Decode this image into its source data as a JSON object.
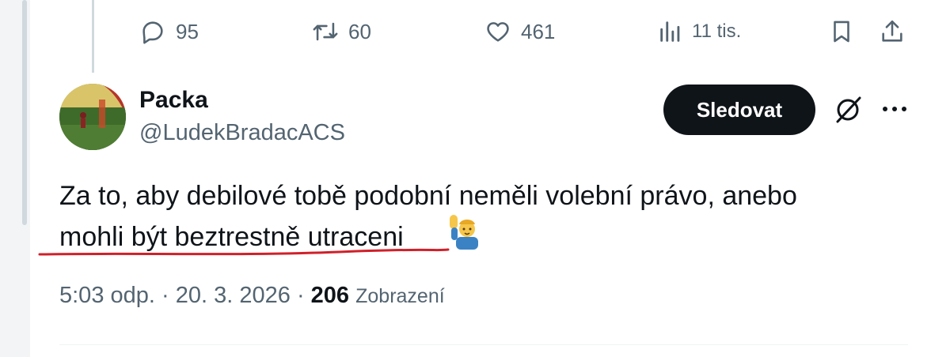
{
  "prev_tweet_actions": {
    "replies": "95",
    "retweets": "60",
    "likes": "461",
    "views": "11 tis."
  },
  "icons": {
    "reply": "reply-icon",
    "retweet": "retweet-icon",
    "like": "heart-icon",
    "views": "analytics-icon",
    "bookmark": "bookmark-icon",
    "share": "share-icon",
    "grok": "grok-icon",
    "more": "more-icon",
    "emoji": "man-raising-hand-emoji"
  },
  "tweet": {
    "display_name": "Packa",
    "handle": "@LudekBradacACS",
    "follow_label": "Sledovat",
    "text_line1": "Za to, aby debilové tobě podobní neměli volební právo, anebo",
    "text_line2": "mohli být beztrestně utraceni",
    "time": "5:03 odp.",
    "date": "20. 3. 2026",
    "views_count": "206",
    "views_label": "Zobrazení"
  },
  "colors": {
    "text": "#0f1419",
    "secondary": "#536471",
    "follow_bg": "#0f1419",
    "underline": "#d0202a"
  }
}
